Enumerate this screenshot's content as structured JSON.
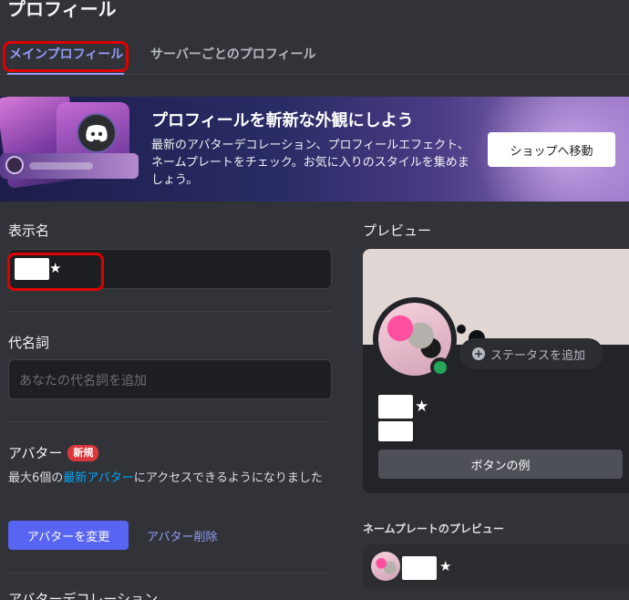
{
  "page": {
    "title": "プロフィール"
  },
  "tabs": [
    {
      "label": "メインプロフィール",
      "active": true
    },
    {
      "label": "サーバーごとのプロフィール",
      "active": false
    }
  ],
  "banner": {
    "heading": "プロフィールを斬新な外観にしよう",
    "description": "最新のアバターデコレーション、プロフィールエフェクト、ネームプレートをチェック。お気に入りのスタイルを集めましょう。",
    "shop_button": "ショップへ移動"
  },
  "display_name": {
    "label": "表示名",
    "value_suffix": "★"
  },
  "pronouns": {
    "label": "代名詞",
    "placeholder": "あなたの代名詞を追加"
  },
  "avatar": {
    "label": "アバター",
    "badge": "新規",
    "desc_prefix": "最大6個の",
    "desc_link": "最新アバター",
    "desc_suffix": "にアクセスできるようになりました",
    "change_button": "アバターを変更",
    "remove_button": "アバター削除"
  },
  "avatar_decoration": {
    "label": "アバターデコレーション"
  },
  "preview": {
    "label": "プレビュー",
    "status_button": "ステータスを追加",
    "name_suffix": "★",
    "example_button": "ボタンの例"
  },
  "nameplate_preview": {
    "label": "ネームプレートのプレビュー",
    "name_suffix": "★"
  },
  "colors": {
    "background": "#313338",
    "accent": "#5865f2",
    "tab_active": "#949cf7",
    "highlight_box": "#e00000",
    "online": "#23a55a"
  }
}
